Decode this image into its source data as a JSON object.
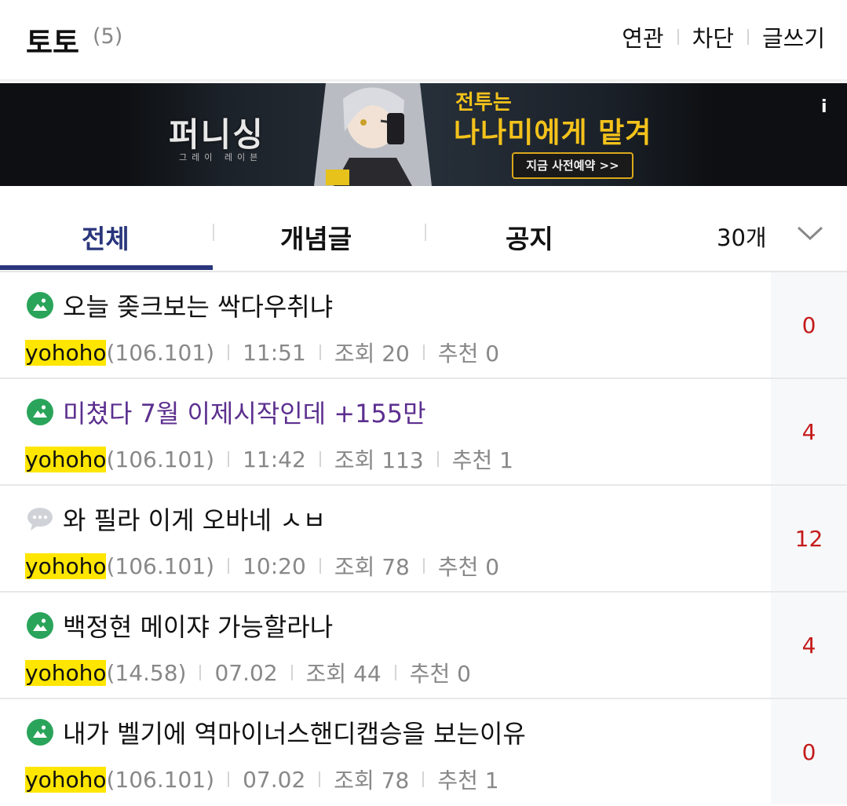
{
  "header": {
    "title": "토토",
    "count": "(5)",
    "actions": [
      "연관",
      "차단",
      "글쓰기"
    ]
  },
  "banner": {
    "logo": "퍼니싱",
    "logo_sub": "그레이 레이븐",
    "headline_1": "전투는",
    "headline_2": "나나미에게 맡겨",
    "cta": "지금 사전예약 >>",
    "info_glyph": "i"
  },
  "tabs": {
    "items": [
      "전체",
      "개념글",
      "공지"
    ],
    "active": 0,
    "page_size": "30개"
  },
  "posts": [
    {
      "icon": "image-post-icon",
      "title": "오늘 좆크보는 싹다우취냐",
      "visited": false,
      "nick": "yohoho",
      "ip": "(106.101)",
      "time": "11:51",
      "views": "조회 20",
      "recommend": "추천 0",
      "comments": "0"
    },
    {
      "icon": "image-post-icon",
      "title": "미쳤다 7월 이제시작인데 +155만",
      "visited": true,
      "nick": "yohoho",
      "ip": "(106.101)",
      "time": "11:42",
      "views": "조회 113",
      "recommend": "추천 1",
      "comments": "4"
    },
    {
      "icon": "text-post-icon",
      "title": "와 필라 이게 오바네 ㅅㅂ",
      "visited": false,
      "nick": "yohoho",
      "ip": "(106.101)",
      "time": "10:20",
      "views": "조회 78",
      "recommend": "추천 0",
      "comments": "12"
    },
    {
      "icon": "image-post-icon",
      "title": "백정현 메이쟈 가능할라나",
      "visited": false,
      "nick": "yohoho",
      "ip": "(14.58)",
      "time": "07.02",
      "views": "조회 44",
      "recommend": "추천 0",
      "comments": "4"
    },
    {
      "icon": "image-post-icon",
      "title": "내가 벨기에 역마이너스핸디캡승을 보는이유",
      "visited": false,
      "nick": "yohoho",
      "ip": "(106.101)",
      "time": "07.02",
      "views": "조회 78",
      "recommend": "추천 1",
      "comments": "0"
    }
  ],
  "colors": {
    "accent": "#29367c",
    "nickname_highlight": "#ffe600",
    "comment_count": "#c41a1a",
    "visited_title": "#5c2f8f",
    "image_icon": "#2aa45a"
  }
}
